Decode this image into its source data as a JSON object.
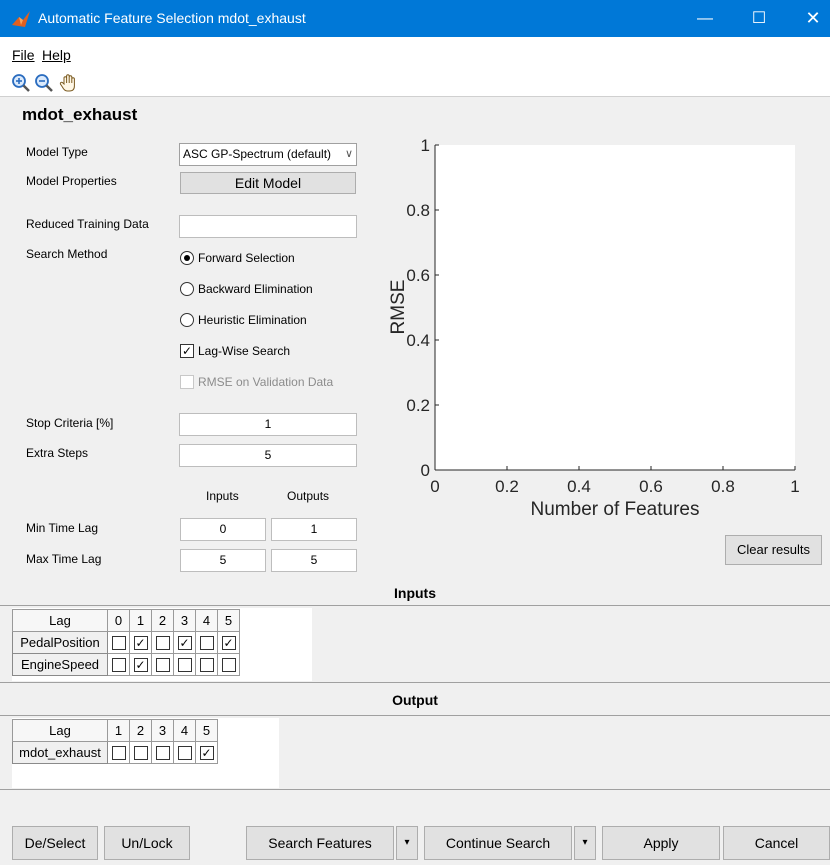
{
  "window": {
    "title": "Automatic Feature Selection mdot_exhaust",
    "minimize": "—",
    "maximize": "☐",
    "close": "✕"
  },
  "menu": {
    "file": "File",
    "help": "Help"
  },
  "toolbar": {
    "icons": [
      "zoom-in-icon",
      "zoom-out-icon",
      "pan-hand-icon"
    ]
  },
  "panel": {
    "title": "mdot_exhaust",
    "model_type_label": "Model Type",
    "model_type_value": "ASC GP-Spectrum (default)",
    "model_properties_label": "Model Properties",
    "edit_model": "Edit Model",
    "reduced_training_label": "Reduced Training Data",
    "reduced_training_value": "",
    "search_method_label": "Search Method",
    "forward_selection": "Forward Selection",
    "backward_elimination": "Backward Elimination",
    "heuristic_elimination": "Heuristic Elimination",
    "lag_wise_search": "Lag-Wise Search",
    "rmse_validation": "RMSE on Validation Data",
    "selected_method": "forward_selection",
    "lag_wise_checked": true,
    "rmse_validation_checked": false,
    "stop_criteria_label": "Stop Criteria [%]",
    "stop_criteria_value": "1",
    "extra_steps_label": "Extra Steps",
    "extra_steps_value": "5",
    "inputs_col": "Inputs",
    "outputs_col": "Outputs",
    "min_time_lag_label": "Min Time Lag",
    "min_time_lag_inputs": "0",
    "min_time_lag_outputs": "1",
    "max_time_lag_label": "Max Time Lag",
    "max_time_lag_inputs": "5",
    "max_time_lag_outputs": "5"
  },
  "chart_data": {
    "type": "line",
    "xlabel": "Number of Features",
    "ylabel": "RMSE",
    "xlim": [
      0,
      1
    ],
    "ylim": [
      0,
      1
    ],
    "xticks": [
      "0",
      "0.2",
      "0.4",
      "0.6",
      "0.8",
      "1"
    ],
    "yticks": [
      "0",
      "0.2",
      "0.4",
      "0.6",
      "0.8",
      "1"
    ],
    "series": []
  },
  "clear_results": "Clear results",
  "inputs_section": {
    "title": "Inputs",
    "lag_header": "Lag",
    "lags": [
      "0",
      "1",
      "2",
      "3",
      "4",
      "5"
    ],
    "rows": [
      {
        "name": "PedalPosition",
        "checks": [
          false,
          true,
          false,
          true,
          false,
          true
        ]
      },
      {
        "name": "EngineSpeed",
        "checks": [
          false,
          true,
          false,
          false,
          false,
          false
        ]
      }
    ]
  },
  "output_section": {
    "title": "Output",
    "lag_header": "Lag",
    "lags": [
      "1",
      "2",
      "3",
      "4",
      "5"
    ],
    "rows": [
      {
        "name": "mdot_exhaust",
        "checks": [
          false,
          false,
          false,
          false,
          true
        ]
      }
    ]
  },
  "buttons": {
    "deselect": "De/Select",
    "unlock": "Un/Lock",
    "search_features": "Search Features",
    "continue_search": "Continue Search",
    "apply": "Apply",
    "cancel": "Cancel",
    "dropdown_arrow": "▾"
  },
  "colors": {
    "titlebar": "#0078d7",
    "plot_bg": "#ffffff",
    "panel_bg": "#f0f0f0"
  }
}
